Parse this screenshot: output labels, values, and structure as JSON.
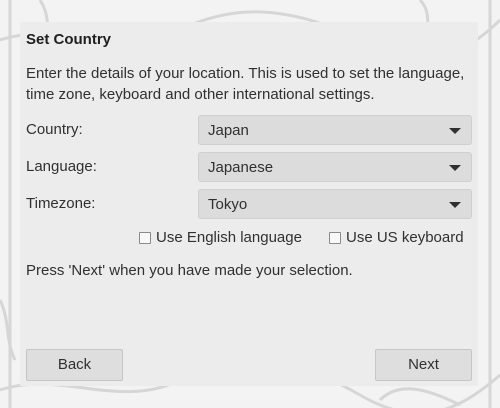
{
  "dialog": {
    "title": "Set Country",
    "description": "Enter the details of your location. This is used to set the language, time zone, keyboard and other international settings.",
    "fields": {
      "country": {
        "label": "Country:",
        "value": "Japan"
      },
      "language": {
        "label": "Language:",
        "value": "Japanese"
      },
      "timezone": {
        "label": "Timezone:",
        "value": "Tokyo"
      }
    },
    "checkboxes": {
      "english": {
        "label": "Use English language",
        "checked": false
      },
      "us_keyboard": {
        "label": "Use US keyboard",
        "checked": false
      }
    },
    "note": "Press 'Next' when you have made your selection.",
    "buttons": {
      "back": "Back",
      "next": "Next"
    }
  }
}
